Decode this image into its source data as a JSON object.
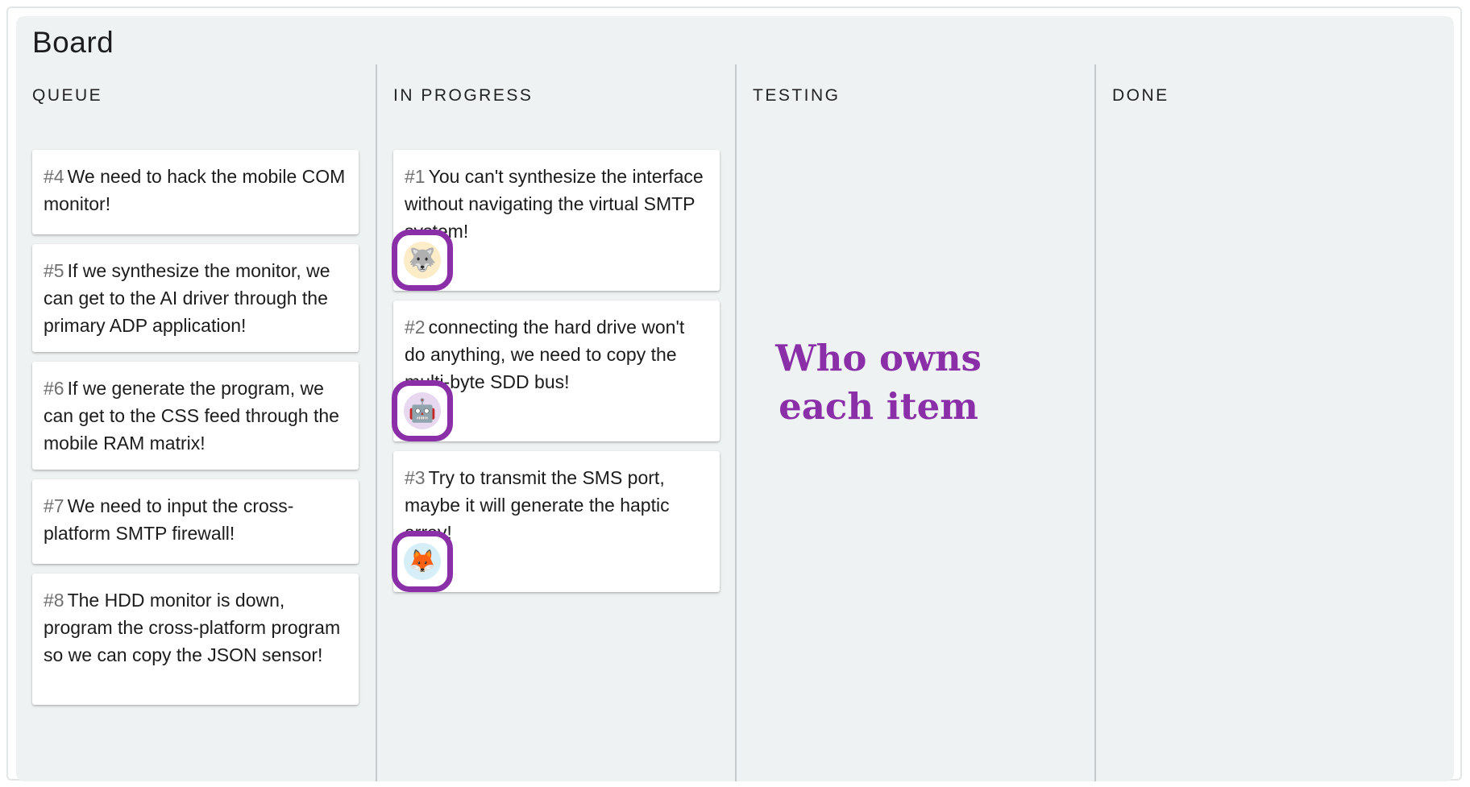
{
  "board": {
    "title": "Board"
  },
  "columns": [
    {
      "title": "QUEUE"
    },
    {
      "title": "IN PROGRESS"
    },
    {
      "title": "TESTING"
    },
    {
      "title": "DONE"
    }
  ],
  "cards": {
    "queue": [
      {
        "num": "#4",
        "text": "We need to hack the mobile COM monitor!"
      },
      {
        "num": "#5",
        "text": "If we synthesize the monitor, we can get to the AI driver through the primary ADP application!"
      },
      {
        "num": "#6",
        "text": "If we generate the program, we can get to the CSS feed through the mobile RAM matrix!"
      },
      {
        "num": "#7",
        "text": "We need to input the cross-platform SMTP firewall!"
      },
      {
        "num": "#8",
        "text": "The HDD monitor is down, program the cross-platform program so we can copy the JSON sensor!"
      }
    ],
    "in_progress": [
      {
        "num": "#1",
        "text": "You can't synthesize the interface without navigating the virtual SMTP system!",
        "owner_icon": "wolf-icon",
        "owner_glyph": "🐺",
        "owner_bg": "#fdecc8"
      },
      {
        "num": "#2",
        "text": "connecting the hard drive won't do anything, we need to copy the multi-byte SDD bus!",
        "owner_icon": "robot-icon",
        "owner_glyph": "🤖",
        "owner_bg": "#e7d8f0"
      },
      {
        "num": "#3",
        "text": "Try to transmit the SMS port, maybe it will generate the haptic array!",
        "owner_icon": "fox-icon",
        "owner_glyph": "🦊",
        "owner_bg": "#d6eef7"
      }
    ]
  },
  "annotation": {
    "text": "Who owns each item"
  },
  "colors": {
    "accent": "#8a2fa8",
    "board_bg": "#eff2f3",
    "divider": "#c4c9cc"
  }
}
